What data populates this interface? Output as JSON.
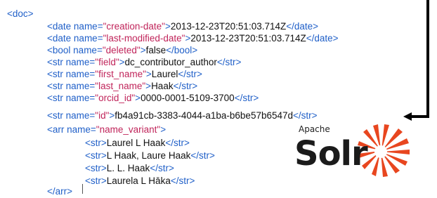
{
  "xml": {
    "doc_open": "<doc>",
    "lines": [
      {
        "tag_open": "<date ",
        "attr": "name=",
        "val": "\"creation-date\"",
        "gt": ">",
        "text": "2013-12-23T20:51:03.714Z",
        "tag_close": "</date>"
      },
      {
        "tag_open": "<date ",
        "attr": "name=",
        "val": "\"last-modified-date\"",
        "gt": ">",
        "text": "2013-12-23T20:51:03.714Z",
        "tag_close": "</date>"
      },
      {
        "tag_open": "<bool ",
        "attr": "name=",
        "val": "\"deleted\"",
        "gt": ">",
        "text": "false",
        "tag_close": "</bool>"
      },
      {
        "tag_open": "<str ",
        "attr": "name=",
        "val": "\"field\"",
        "gt": ">",
        "text": "dc_contributor_author",
        "tag_close": "</str>"
      },
      {
        "tag_open": "<str ",
        "attr": "name=",
        "val": "\"first_name\"",
        "gt": ">",
        "text": "Laurel",
        "tag_close": "</str>"
      },
      {
        "tag_open": "<str ",
        "attr": "name=",
        "val": "\"last_name\"",
        "gt": ">",
        "text": "Haak",
        "tag_close": "</str>"
      },
      {
        "tag_open": "<str ",
        "attr": "name=",
        "val": "\"orcid_id\"",
        "gt": ">",
        "text": "0000-0001-5109-3700",
        "tag_close": "</str>"
      },
      {
        "tag_open": "<str ",
        "attr": "name=",
        "val": "\"id\"",
        "gt": ">",
        "text": "fb4a91cb-3383-4044-a1ba-b6be57b6547d",
        "tag_close": "</str>"
      }
    ],
    "arr_open": {
      "tag_open": "<arr ",
      "attr": "name=",
      "val": "\"name_variant\"",
      "gt": ">"
    },
    "variants": [
      {
        "tag_open": "<str>",
        "text": "Laurel L Haak",
        "tag_close": "</str>"
      },
      {
        "tag_open": "<str>",
        "text": "L Haak, Laure Haak",
        "tag_close": "</str>"
      },
      {
        "tag_open": "<str>",
        "text": "L. L. Haak",
        "tag_close": "</str>"
      },
      {
        "tag_open": "<str>",
        "text": "Laurela L Hāka",
        "tag_close": "</str>"
      }
    ],
    "arr_close": "</arr>"
  },
  "logo": {
    "apache": "Apache",
    "solr": "Solr",
    "colors": {
      "sun": "#e8461f",
      "text": "#1b1b1b"
    },
    "icon": "solr-sun-icon"
  },
  "colors": {
    "tag": "#1f5fc8",
    "value": "#c0245a",
    "text": "#111111"
  },
  "arrow_icon": "arrow-left-icon"
}
